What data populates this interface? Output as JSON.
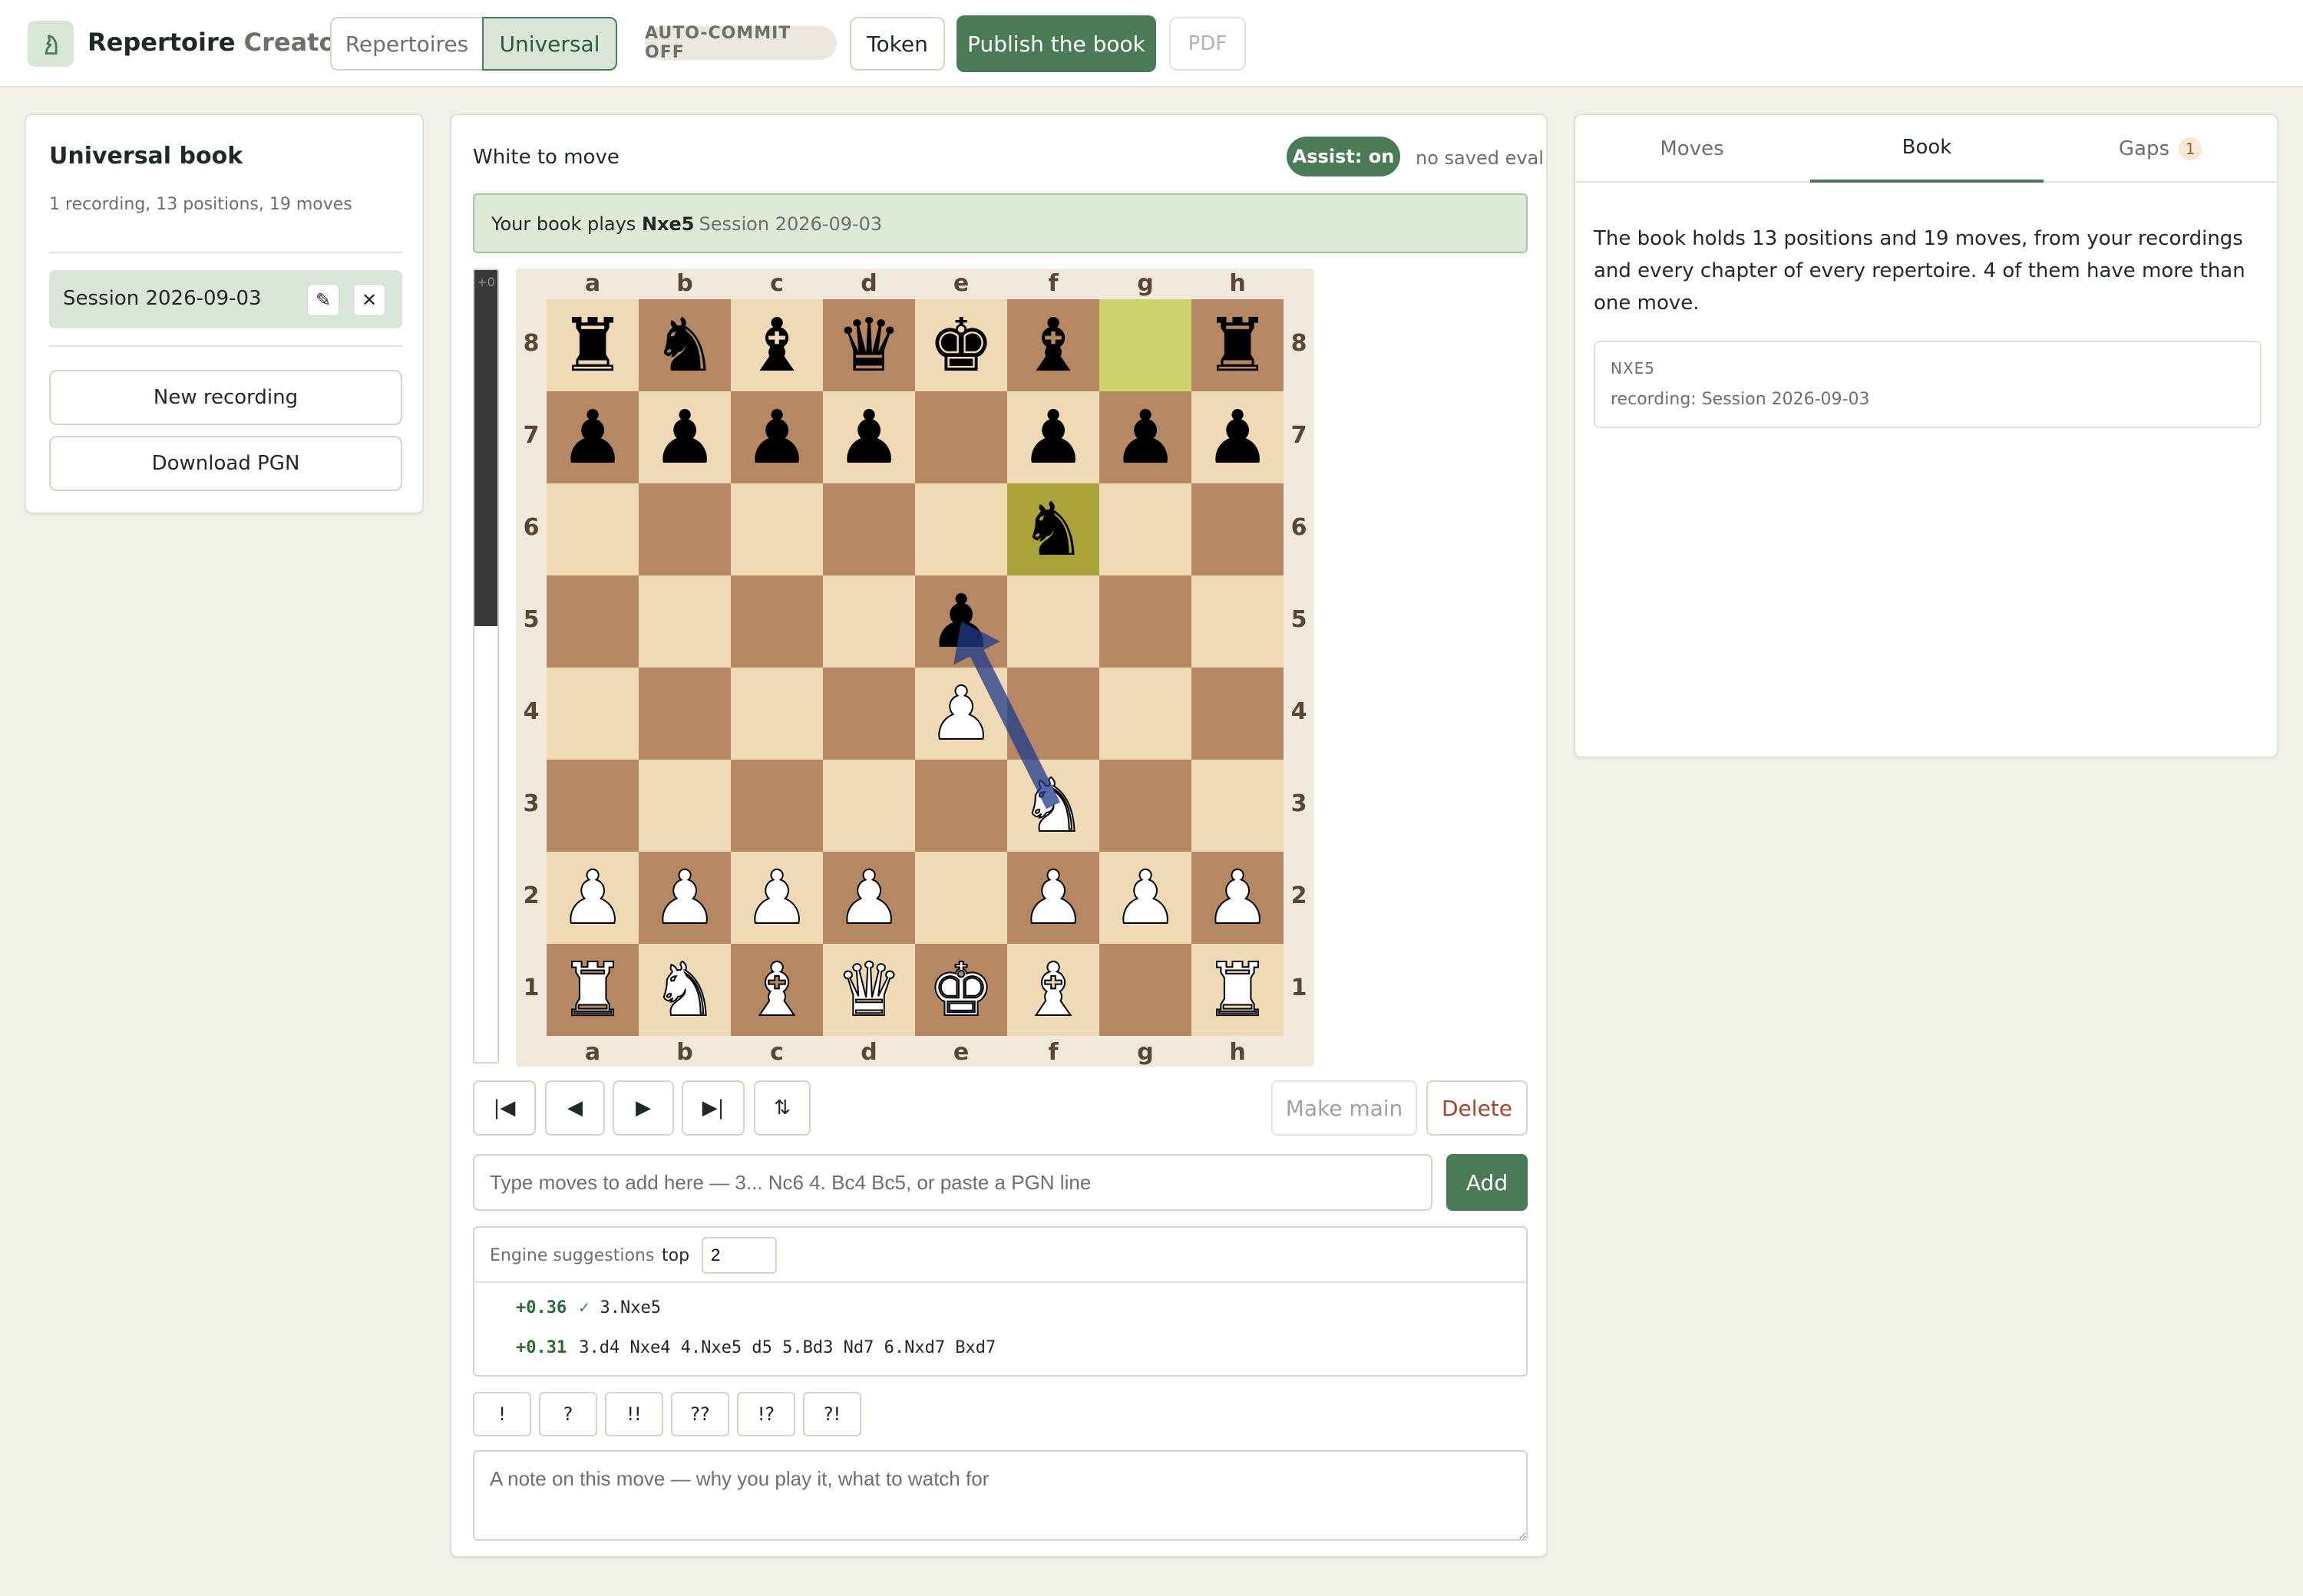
{
  "app": {
    "brand_main": "Repertoire",
    "brand_muted": " Creator",
    "icon": "knight-icon"
  },
  "topbar": {
    "seg_repertoires": "Repertoires",
    "seg_universal": "Universal",
    "auto_commit": "AUTO-COMMIT OFF",
    "token": "Token",
    "publish": "Publish the book",
    "pdf": "PDF"
  },
  "left": {
    "title": "Universal book",
    "subtitle": "1 recording, 13 positions, 19 moves",
    "session": "Session 2026-09-03",
    "new_recording": "New recording",
    "download_pgn": "Download PGN"
  },
  "center": {
    "to_move": "White to move",
    "assist": "Assist: on",
    "no_eval": "no saved eval",
    "book_plays_prefix": "Your book plays",
    "book_plays_move": "Nxe5",
    "book_plays_session": "Session 2026-09-03",
    "eval_label": "+0",
    "eval_white_fraction": 0.55,
    "files": [
      "a",
      "b",
      "c",
      "d",
      "e",
      "f",
      "g",
      "h"
    ],
    "ranks": [
      "8",
      "7",
      "6",
      "5",
      "4",
      "3",
      "2",
      "1"
    ],
    "board": [
      [
        "bR",
        "bN",
        "bB",
        "bQ",
        "bK",
        "bB",
        "",
        "bR"
      ],
      [
        "bP",
        "bP",
        "bP",
        "bP",
        "",
        "bP",
        "bP",
        "bP"
      ],
      [
        "",
        "",
        "",
        "",
        "",
        "bN",
        "",
        ""
      ],
      [
        "",
        "",
        "",
        "",
        "bP",
        "",
        "",
        ""
      ],
      [
        "",
        "",
        "",
        "",
        "wP",
        "",
        "",
        ""
      ],
      [
        "",
        "",
        "",
        "",
        "",
        "wN",
        "",
        ""
      ],
      [
        "wP",
        "wP",
        "wP",
        "wP",
        "",
        "wP",
        "wP",
        "wP"
      ],
      [
        "wR",
        "wN",
        "wB",
        "wQ",
        "wK",
        "wB",
        "",
        "wR"
      ]
    ],
    "highlight_from": "g8",
    "highlight_to": "f6",
    "arrow_from": "f3",
    "arrow_to": "e5",
    "arrow_color": "#1e3a8a",
    "nav": [
      "|◀",
      "◀",
      "▶",
      "▶|",
      "⇅"
    ],
    "make_main": "Make main",
    "delete": "Delete",
    "move_placeholder": "Type moves to add here — 3... Nc6 4. Bc4 Bc5, or paste a PGN line",
    "add": "Add",
    "engine_label": "Engine suggestions",
    "engine_top_label": "top",
    "engine_top_value": "2",
    "engine_lines": [
      {
        "score": "+0.36",
        "check": "✓",
        "moves": "3.Nxe5"
      },
      {
        "score": "+0.31",
        "check": "",
        "moves": "3.d4 Nxe4 4.Nxe5 d5 5.Bd3 Nd7 6.Nxd7 Bxd7"
      }
    ],
    "glyphs": [
      "!",
      "?",
      "!!",
      "??",
      "!?",
      "?!"
    ],
    "note_placeholder": "A note on this move — why you play it, what to watch for"
  },
  "right": {
    "tab_moves": "Moves",
    "tab_book": "Book",
    "tab_gaps": "Gaps",
    "gaps_count": "1",
    "book_text": "The book holds 13 positions and 19 moves, from your recordings and every chapter of every repertoire. 4 of them have more than one move.",
    "card_key": "NXE5",
    "card_value": "recording: Session 2026-09-03"
  },
  "colors": {
    "accent": "#4a7a56",
    "light_square": "#f0d9b5",
    "dark_square": "#b58863"
  }
}
